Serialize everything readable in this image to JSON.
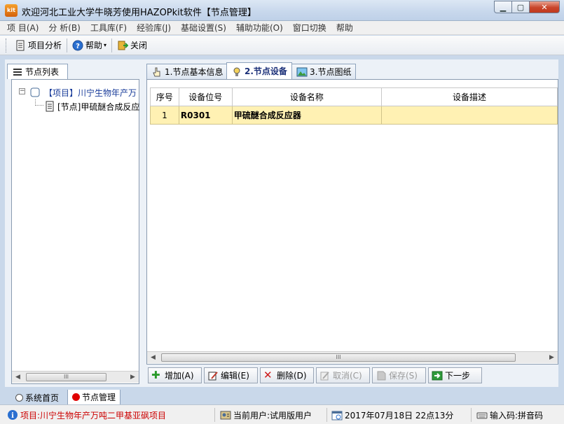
{
  "window": {
    "title": "欢迎河北工业大学牛晓芳使用HAZOPkit软件【节点管理】",
    "app_icon_text": "kit"
  },
  "menu": [
    "项  目(A)",
    "分  析(B)",
    "工具库(F)",
    "经验库(J)",
    "基础设置(S)",
    "辅助功能(O)",
    "窗口切换",
    "帮助"
  ],
  "toolbar": {
    "project_analysis": "项目分析",
    "help": "帮助",
    "close": "关闭"
  },
  "left_panel": {
    "tab_label": "节点列表",
    "tree": {
      "project": "【项目】川宁生物年产万",
      "node": "[节点]甲硫醚合成反应"
    }
  },
  "tabs": [
    {
      "label": "1.节点基本信息"
    },
    {
      "label": "2.节点设备"
    },
    {
      "label": "3.节点图纸"
    }
  ],
  "grid": {
    "headers": [
      "序号",
      "设备位号",
      "设备名称",
      "设备描述"
    ],
    "rows": [
      {
        "no": "1",
        "tag": "R0301",
        "name": "甲硫醚合成反应器",
        "desc": ""
      }
    ]
  },
  "actions": {
    "add": "增加(A)",
    "edit": "编辑(E)",
    "delete": "删除(D)",
    "cancel": "取消(C)",
    "save": "保存(S)",
    "next": "下一步"
  },
  "bottom_tabs": {
    "home": "系统首页",
    "node_mgmt": "节点管理"
  },
  "status": {
    "project": "项目:川宁生物年产万吨二甲基亚砜项目",
    "user": "当前用户:试用版用户",
    "datetime": "2017年07月18日  22点13分",
    "input_method": "输入码:拼音码"
  },
  "colors": {
    "selected_row": "#fff1b3",
    "status_project_text": "#cc0000",
    "node_mgmt_dot": "#e00000"
  }
}
